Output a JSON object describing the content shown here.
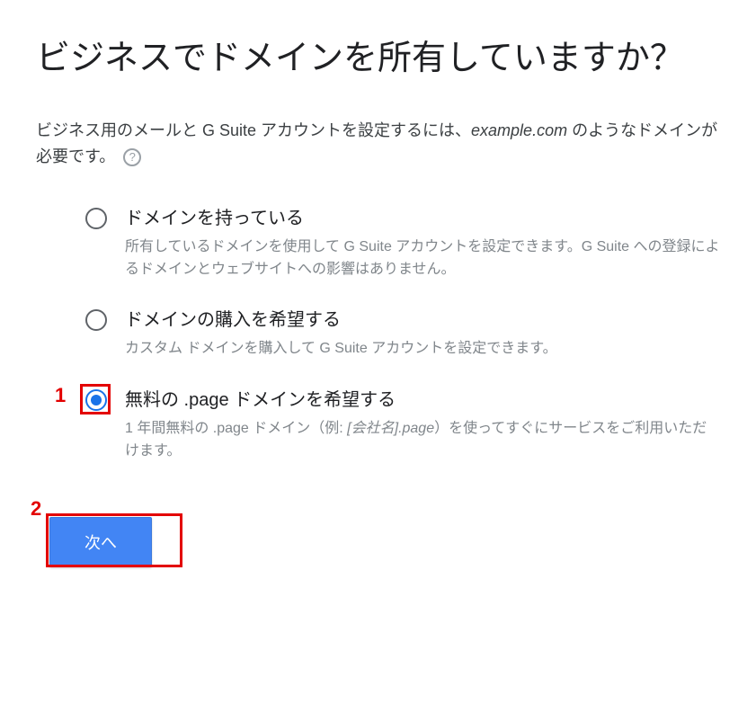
{
  "heading": "ビジネスでドメインを所有していますか？",
  "intro": {
    "part1": "ビジネス用のメールと G Suite アカウントを設定するには、",
    "example": "example.com ",
    "part2": "のようなドメインが必要です。"
  },
  "help_icon_label": "?",
  "options": [
    {
      "title": "ドメインを持っている",
      "desc": "所有しているドメインを使用して G Suite アカウントを設定できます。G Suite への登録によるドメインとウェブサイトへの影響はありません。",
      "selected": false
    },
    {
      "title": "ドメインの購入を希望する",
      "desc": "カスタム ドメインを購入して G Suite アカウントを設定できます。",
      "selected": false
    },
    {
      "title": "無料の .page ドメインを希望する",
      "desc_part1": "1 年間無料の .page ドメイン（例: ",
      "desc_italic": "[会社名].page",
      "desc_part2": "）を使ってすぐにサービスをご利用いただけます。",
      "selected": true
    }
  ],
  "annotations": {
    "one": "1",
    "two": "2"
  },
  "next_button": "次へ"
}
